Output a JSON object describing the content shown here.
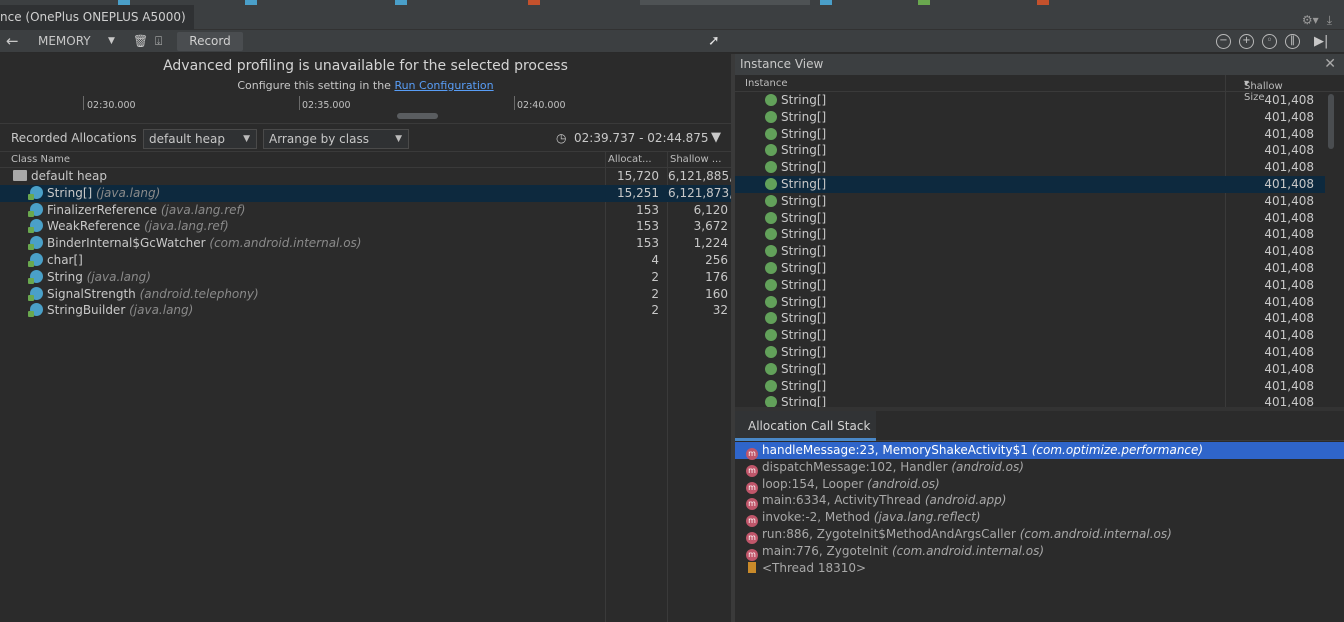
{
  "window": {
    "title": "nce (OnePlus ONEPLUS A5000)"
  },
  "toolbar": {
    "profiler": "MEMORY",
    "record_label": "Record"
  },
  "notice": {
    "heading": "Advanced profiling is unavailable for the selected process",
    "sub_prefix": "Configure this setting in the",
    "link": "Run Configuration"
  },
  "timeline": {
    "labels": [
      "02:30.000",
      "02:35.000",
      "02:40.000"
    ]
  },
  "filters": {
    "recorded_label": "Recorded Allocations",
    "heap": "default heap",
    "arrange": "Arrange by class",
    "range": "02:39.737 - 02:44.875"
  },
  "class_table": {
    "headers": [
      "Class Name",
      "Allocat...",
      "Shallow ..."
    ],
    "rows": [
      {
        "name": "default heap",
        "pkg": "",
        "alloc": "15,720",
        "shallow": "6,121,885,",
        "type": "heap"
      },
      {
        "name": "String[]",
        "pkg": "(java.lang)",
        "alloc": "15,251",
        "shallow": "6,121,873,",
        "type": "class",
        "selected": true
      },
      {
        "name": "FinalizerReference",
        "pkg": "(java.lang.ref)",
        "alloc": "153",
        "shallow": "6,120",
        "type": "class"
      },
      {
        "name": "WeakReference",
        "pkg": "(java.lang.ref)",
        "alloc": "153",
        "shallow": "3,672",
        "type": "class"
      },
      {
        "name": "BinderInternal$GcWatcher",
        "pkg": "(com.android.internal.os)",
        "alloc": "153",
        "shallow": "1,224",
        "type": "class"
      },
      {
        "name": "char[]",
        "pkg": "",
        "alloc": "4",
        "shallow": "256",
        "type": "class"
      },
      {
        "name": "String",
        "pkg": "(java.lang)",
        "alloc": "2",
        "shallow": "176",
        "type": "class"
      },
      {
        "name": "SignalStrength",
        "pkg": "(android.telephony)",
        "alloc": "2",
        "shallow": "160",
        "type": "class"
      },
      {
        "name": "StringBuilder",
        "pkg": "(java.lang)",
        "alloc": "2",
        "shallow": "32",
        "type": "class"
      }
    ]
  },
  "instance_view": {
    "title": "Instance View",
    "headers": [
      "Instance",
      "Shallow Size"
    ],
    "rows": [
      {
        "name": "String[]",
        "size": "401,408"
      },
      {
        "name": "String[]",
        "size": "401,408"
      },
      {
        "name": "String[]",
        "size": "401,408"
      },
      {
        "name": "String[]",
        "size": "401,408"
      },
      {
        "name": "String[]",
        "size": "401,408"
      },
      {
        "name": "String[]",
        "size": "401,408",
        "selected": true
      },
      {
        "name": "String[]",
        "size": "401,408"
      },
      {
        "name": "String[]",
        "size": "401,408"
      },
      {
        "name": "String[]",
        "size": "401,408"
      },
      {
        "name": "String[]",
        "size": "401,408"
      },
      {
        "name": "String[]",
        "size": "401,408"
      },
      {
        "name": "String[]",
        "size": "401,408"
      },
      {
        "name": "String[]",
        "size": "401,408"
      },
      {
        "name": "String[]",
        "size": "401,408"
      },
      {
        "name": "String[]",
        "size": "401,408"
      },
      {
        "name": "String[]",
        "size": "401,408"
      },
      {
        "name": "String[]",
        "size": "401,408"
      },
      {
        "name": "String[]",
        "size": "401,408"
      },
      {
        "name": "String[]",
        "size": "401,408"
      }
    ]
  },
  "call_stack": {
    "tab": "Allocation Call Stack",
    "rows": [
      {
        "text": "handleMessage:23, MemoryShakeActivity$1",
        "pkg": "(com.optimize.performance)",
        "icon": "method",
        "selected": true
      },
      {
        "text": "dispatchMessage:102, Handler",
        "pkg": "(android.os)",
        "icon": "method"
      },
      {
        "text": "loop:154, Looper",
        "pkg": "(android.os)",
        "icon": "method"
      },
      {
        "text": "main:6334, ActivityThread",
        "pkg": "(android.app)",
        "icon": "method"
      },
      {
        "text": "invoke:-2, Method",
        "pkg": "(java.lang.reflect)",
        "icon": "method"
      },
      {
        "text": "run:886, ZygoteInit$MethodAndArgsCaller",
        "pkg": "(com.android.internal.os)",
        "icon": "method"
      },
      {
        "text": "main:776, ZygoteInit",
        "pkg": "(com.android.internal.os)",
        "icon": "method"
      },
      {
        "text": "<Thread 18310>",
        "pkg": "",
        "icon": "thread"
      }
    ]
  },
  "colors": {
    "background": "#2b2b2b",
    "selection": "#0d293e",
    "active_selection": "#2f65ca",
    "link": "#589df6"
  }
}
